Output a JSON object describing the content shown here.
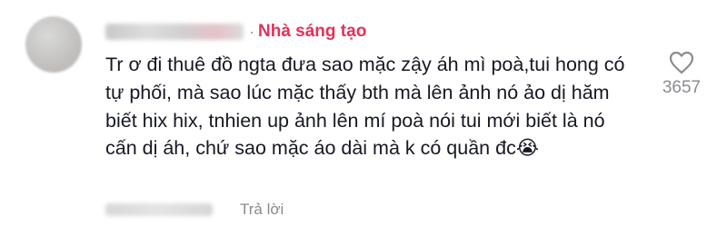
{
  "comment": {
    "badge": "Nhà sáng tạo",
    "separator": "·",
    "text": "Tr ơ đi thuê đồ ngta đưa sao mặc zậy áh mì poà,tui hong có tự phối, mà sao lúc mặc thấy bth mà lên ảnh nó ảo dị hăm biết hix hix, tnhien up ảnh lên mí poà nói tui mới biết là nó cấn dị áh, chứ sao mặc áo dài mà k có quần đc😭",
    "like_count": "3657",
    "reply_label": "Trả lời",
    "like_icon": "heart-outline-icon"
  },
  "colors": {
    "badge": "#e3315a",
    "text": "#161823",
    "muted": "#8a8b91"
  }
}
